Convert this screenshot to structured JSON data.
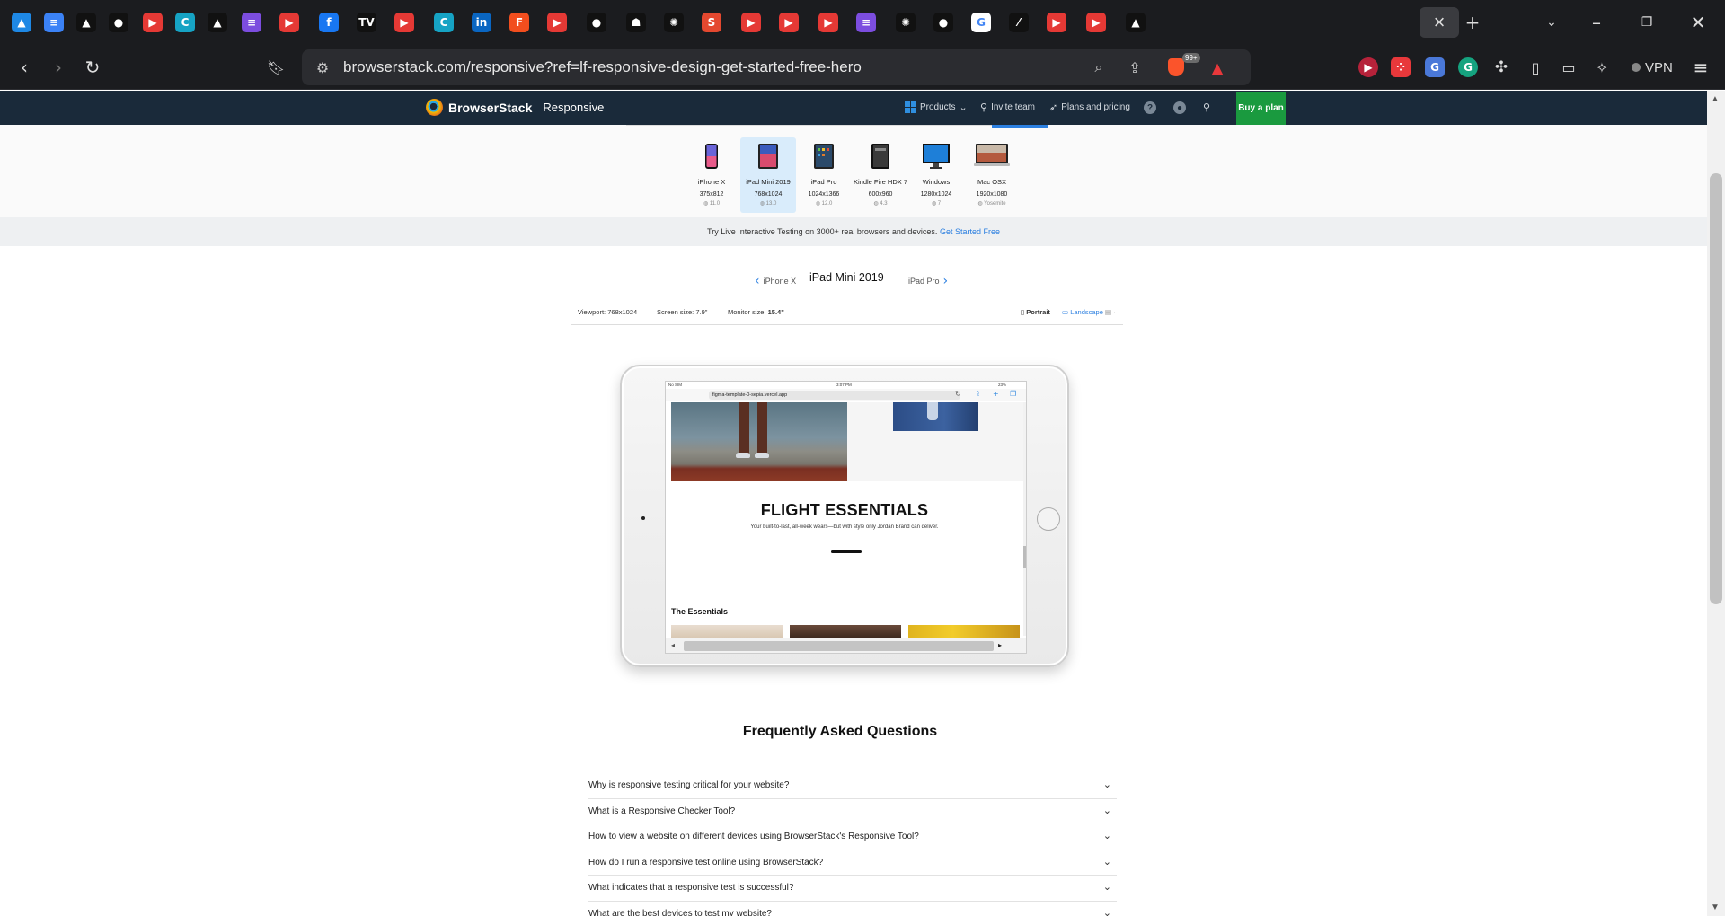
{
  "browser": {
    "tabs": [
      {
        "icon": "google-drive-icon",
        "color": "#1e88e5",
        "glyph": "▲"
      },
      {
        "icon": "google-docs-icon",
        "color": "#3b82f6",
        "glyph": "≡"
      },
      {
        "icon": "notion-triangle-icon",
        "color": "#111111",
        "glyph": "▲"
      },
      {
        "icon": "github-icon",
        "color": "#111111",
        "glyph": "●"
      },
      {
        "icon": "youtube-icon",
        "color": "#e53935",
        "glyph": "▶"
      },
      {
        "icon": "canva-icon",
        "color": "#16a3c4",
        "glyph": "C"
      },
      {
        "icon": "notion-triangle-icon",
        "color": "#111111",
        "glyph": "▲"
      },
      {
        "icon": "forms-icon",
        "color": "#7c4ddf",
        "glyph": "≡"
      },
      {
        "icon": "youtube-icon",
        "color": "#e53935",
        "glyph": "▶"
      },
      {
        "icon": "facebook-icon",
        "color": "#1877f2",
        "glyph": "f"
      },
      {
        "icon": "tradingview-icon",
        "color": "#111111",
        "glyph": "TV"
      },
      {
        "icon": "youtube-icon",
        "color": "#e53935",
        "glyph": "▶"
      },
      {
        "icon": "canva-icon",
        "color": "#16a3c4",
        "glyph": "C"
      },
      {
        "icon": "linkedin-icon",
        "color": "#0a66c2",
        "glyph": "in"
      },
      {
        "icon": "figma-icon",
        "color": "#f24e1e",
        "glyph": "F"
      },
      {
        "icon": "youtube-icon",
        "color": "#e53935",
        "glyph": "▶"
      },
      {
        "icon": "github-icon",
        "color": "#111111",
        "glyph": "●"
      },
      {
        "icon": "ghost-icon",
        "color": "#111111",
        "glyph": "☗"
      },
      {
        "icon": "openai-icon",
        "color": "#111111",
        "glyph": "✺"
      },
      {
        "icon": "s-app-icon",
        "color": "#e4482f",
        "glyph": "S"
      },
      {
        "icon": "youtube-icon",
        "color": "#e53935",
        "glyph": "▶"
      },
      {
        "icon": "youtube-icon",
        "color": "#e53935",
        "glyph": "▶"
      },
      {
        "icon": "youtube-icon",
        "color": "#e53935",
        "glyph": "▶"
      },
      {
        "icon": "forms-icon",
        "color": "#7c4ddf",
        "glyph": "≡"
      },
      {
        "icon": "openai-icon",
        "color": "#111111",
        "glyph": "✺"
      },
      {
        "icon": "github-icon",
        "color": "#111111",
        "glyph": "●"
      },
      {
        "icon": "google-icon",
        "color": "#ffffff",
        "glyph": "G"
      },
      {
        "icon": "slash-icon",
        "color": "#111111",
        "glyph": "⁄"
      },
      {
        "icon": "youtube-icon",
        "color": "#e53935",
        "glyph": "▶"
      },
      {
        "icon": "youtube-icon",
        "color": "#e53935",
        "glyph": "▶"
      },
      {
        "icon": "notion-triangle-icon",
        "color": "#111111",
        "glyph": "▲"
      }
    ],
    "url": "browserstack.com/responsive?ref=lf-responsive-design-get-started-free-hero",
    "brave_badge": "99+",
    "vpn_label": "VPN"
  },
  "header": {
    "brand": "BrowserStack",
    "product": "Responsive",
    "nav": {
      "products": "Products",
      "invite": "Invite team",
      "plans": "Plans and pricing"
    },
    "buy_plan": "Buy a plan"
  },
  "devices": [
    {
      "name": "iPhone X",
      "res": "375x812",
      "os": "11.0",
      "selected": false
    },
    {
      "name": "iPad Mini 2019",
      "res": "768x1024",
      "os": "13.0",
      "selected": true
    },
    {
      "name": "iPad Pro",
      "res": "1024x1366",
      "os": "12.0",
      "selected": false
    },
    {
      "name": "Kindle Fire HDX 7",
      "res": "600x960",
      "os": "4.3",
      "selected": false
    },
    {
      "name": "Windows",
      "res": "1280x1024",
      "os": "7",
      "selected": false
    },
    {
      "name": "Mac OSX",
      "res": "1920x1080",
      "os": "Yosemite",
      "selected": false
    }
  ],
  "promo": {
    "text": "Try Live Interactive Testing on 3000+ real browsers and devices.",
    "link": "Get Started Free"
  },
  "switcher": {
    "prev": "iPhone X",
    "current": "iPad Mini 2019",
    "next": "iPad Pro"
  },
  "viewport_info": {
    "viewport_label": "Viewport:",
    "viewport": "768x1024",
    "screen_label": "Screen size:",
    "screen": "7.9\"",
    "monitor_label": "Monitor size:",
    "monitor": "15.4\"",
    "portrait": "Portrait",
    "landscape": "Landscape"
  },
  "ipad_screen": {
    "status_left": "No SIM",
    "status_time": "3:07 PM",
    "status_right": "23%",
    "url": "figma-template-0-sepia.vercel.app",
    "hero_title": "FLIGHT ESSENTIALS",
    "hero_sub": "Your built-to-last, all-week wears—but with style only Jordan Brand can deliver.",
    "section_title": "The Essentials"
  },
  "faq": {
    "title": "Frequently Asked Questions",
    "items": [
      "Why is responsive testing critical for your website?",
      "What is a Responsive Checker Tool?",
      "How to view a website on different devices using BrowserStack's Responsive Tool?",
      "How do I run a responsive test online using BrowserStack?",
      "What indicates that a responsive test is successful?",
      "What are the best devices to test my website?"
    ]
  },
  "colors": {
    "header_bg": "#1a2a3a",
    "accent": "#2b7fe0",
    "buy_plan": "#1a9a3f",
    "selected_device": "#d9ecfb"
  }
}
